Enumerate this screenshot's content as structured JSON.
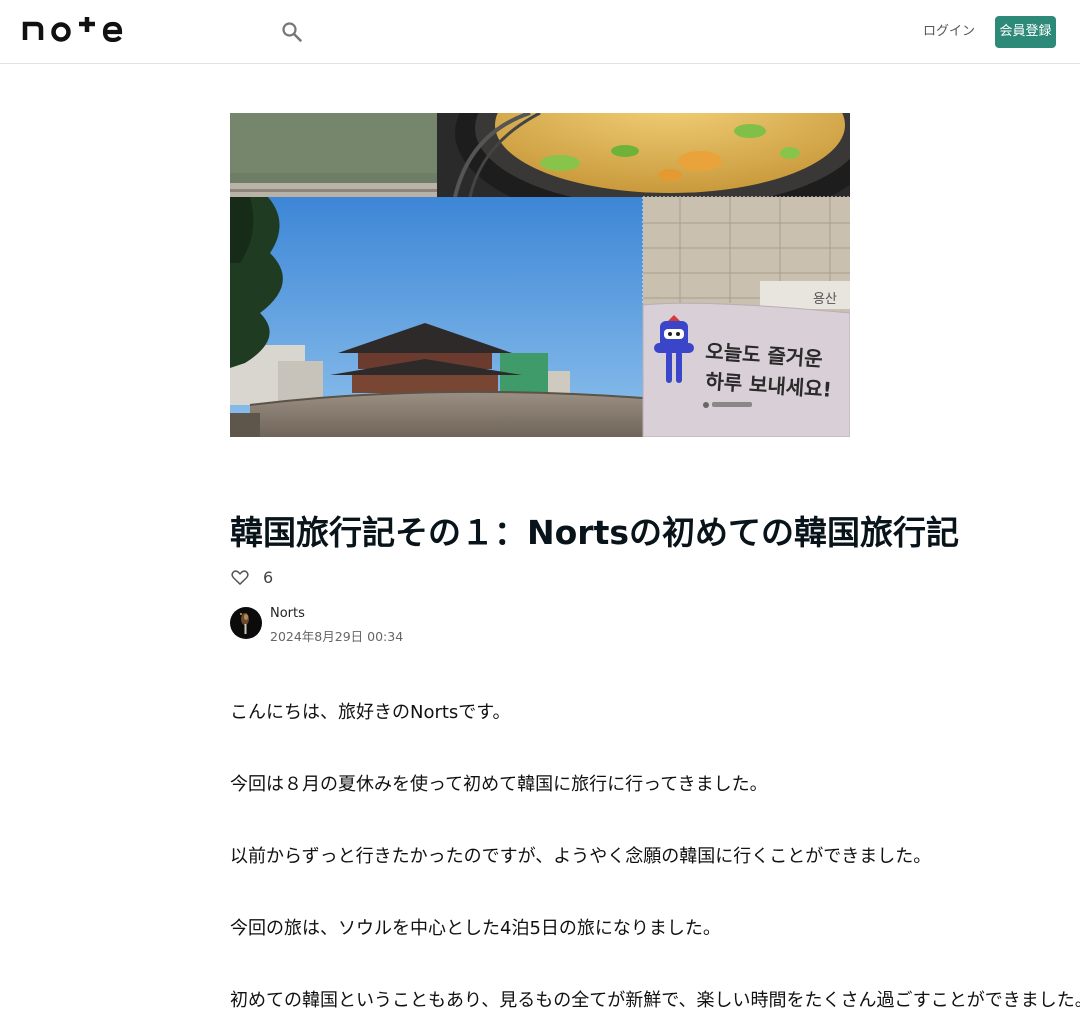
{
  "header": {
    "logo_text": "note",
    "login_label": "ログイン",
    "signup_label": "会員登録"
  },
  "hero": {
    "sign_line1": "오늘도 즐거운",
    "sign_line2": "하루 보내세요!",
    "station_sign": "용산"
  },
  "article": {
    "title": "韓国旅行記その１：Nortsの初めての韓国旅行記",
    "like_count": "6",
    "author_name": "Norts",
    "date": "2024年8月29日 00:34"
  },
  "paragraphs": [
    "こんにちは、旅好きのNortsです。",
    "今回は８月の夏休みを使って初めて韓国に旅行に行ってきました。",
    "以前からずっと行きたかったのですが、ようやく念願の韓国に行くことができました。",
    "今回の旅は、ソウルを中心とした4泊5日の旅になりました。",
    "初めての韓国ということもあり、見るもの全てが新鮮で、楽しい時間をたくさん過ごすことができました。"
  ],
  "colors": {
    "accent": "#2d8a79",
    "title": "#08131a"
  }
}
